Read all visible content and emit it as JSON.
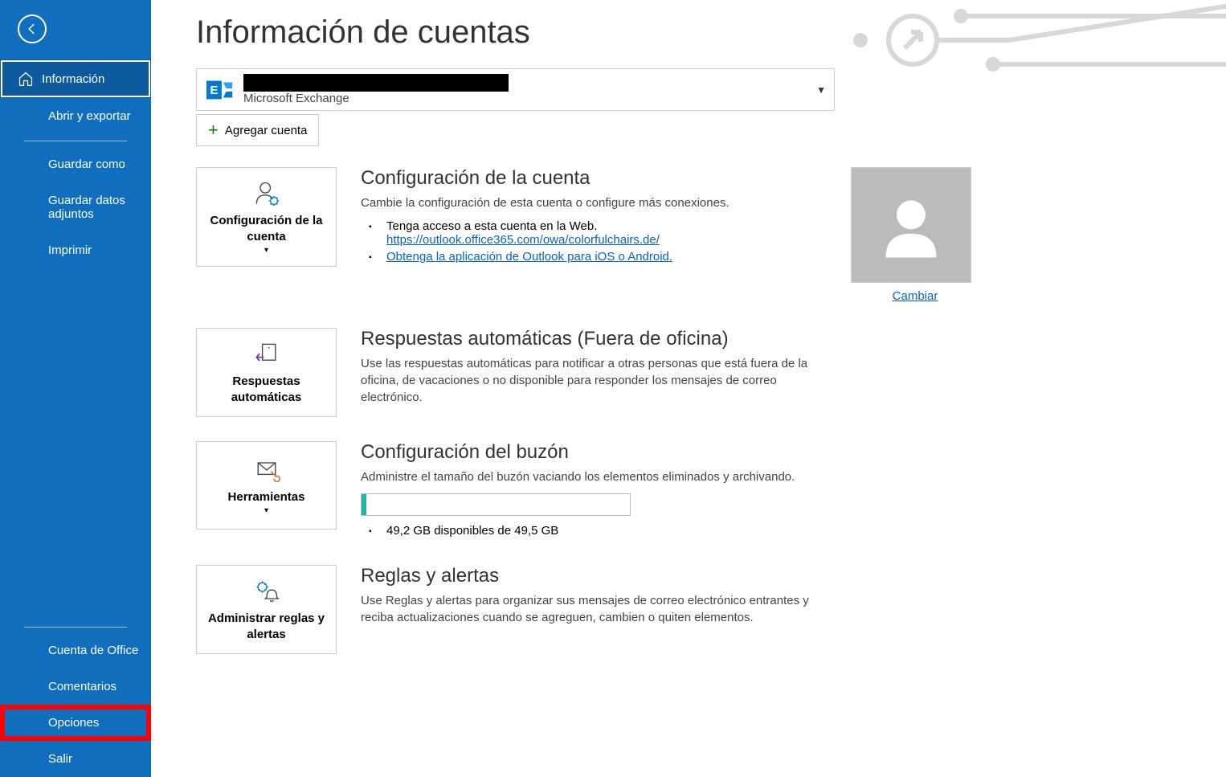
{
  "sidebar": {
    "items": [
      {
        "label": "Información"
      },
      {
        "label": "Abrir y exportar"
      },
      {
        "label": "Guardar como"
      },
      {
        "label": "Guardar datos adjuntos"
      },
      {
        "label": "Imprimir"
      }
    ],
    "bottom": [
      {
        "label": "Cuenta de Office"
      },
      {
        "label": "Comentarios"
      },
      {
        "label": "Opciones"
      },
      {
        "label": "Salir"
      }
    ]
  },
  "header": {
    "title": "Información de cuentas"
  },
  "account": {
    "type": "Microsoft Exchange",
    "add_label": "Agregar cuenta"
  },
  "sections": {
    "config": {
      "btn": "Configuración de la cuenta",
      "title": "Configuración de la cuenta",
      "desc": "Cambie la configuración de esta cuenta o configure más conexiones.",
      "bullet1": "Tenga acceso a esta cuenta en la Web.",
      "link1": "https://outlook.office365.com/owa/colorfulchairs.de/",
      "link2": "Obtenga la aplicación de Outlook para iOS o Android.",
      "change": "Cambiar"
    },
    "auto": {
      "btn": "Respuestas automáticas",
      "title": "Respuestas automáticas (Fuera de oficina)",
      "desc": "Use las respuestas automáticas para notificar a otras personas que está fuera de la oficina, de vacaciones o no disponible para responder los mensajes de correo electrónico."
    },
    "mailbox": {
      "btn": "Herramientas",
      "title": "Configuración del buzón",
      "desc": "Administre el tamaño del buzón vaciando los elementos eliminados y archivando.",
      "storage": "49,2 GB disponibles de 49,5 GB"
    },
    "rules": {
      "btn": "Administrar reglas y alertas",
      "title": "Reglas y alertas",
      "desc": "Use Reglas y alertas para organizar sus mensajes de correo electrónico entrantes y reciba actualizaciones cuando se agreguen, cambien o quiten elementos."
    }
  }
}
